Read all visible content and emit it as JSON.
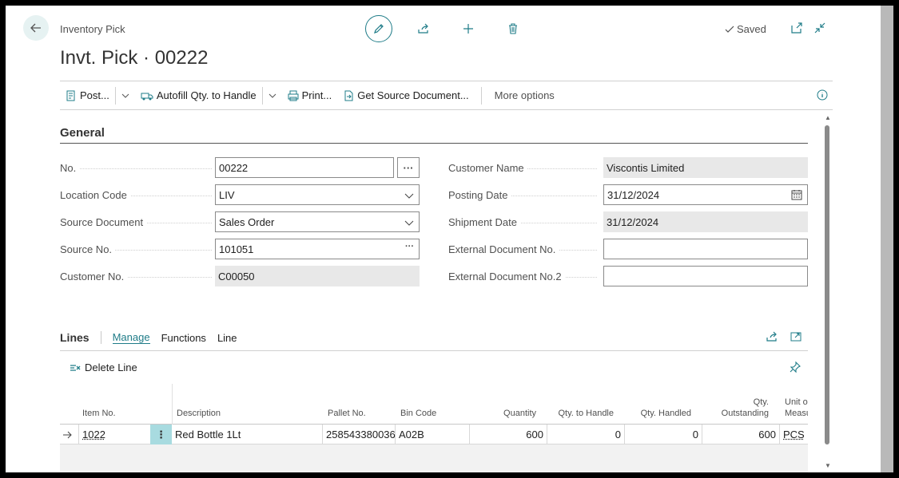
{
  "header": {
    "breadcrumb": "Inventory Pick",
    "title": "Invt. Pick · 00222",
    "status": "Saved"
  },
  "actionbar": {
    "post": "Post...",
    "autofill": "Autofill Qty. to Handle",
    "print": "Print...",
    "get_source": "Get Source Document...",
    "more": "More options"
  },
  "general": {
    "title": "General",
    "fields": {
      "no": {
        "label": "No.",
        "value": "00222"
      },
      "location_code": {
        "label": "Location Code",
        "value": "LIV"
      },
      "source_document": {
        "label": "Source Document",
        "value": "Sales Order"
      },
      "source_no": {
        "label": "Source No.",
        "value": "101051"
      },
      "customer_no": {
        "label": "Customer No.",
        "value": "C00050"
      },
      "customer_name": {
        "label": "Customer Name",
        "value": "Viscontis Limited"
      },
      "posting_date": {
        "label": "Posting Date",
        "value": "31/12/2024"
      },
      "shipment_date": {
        "label": "Shipment Date",
        "value": "31/12/2024"
      },
      "external_doc_no": {
        "label": "External Document No.",
        "value": ""
      },
      "external_doc_no2": {
        "label": "External Document No.2",
        "value": ""
      }
    }
  },
  "lines": {
    "title": "Lines",
    "tabs": [
      "Manage",
      "Functions",
      "Line"
    ],
    "delete_line": "Delete Line",
    "columns": {
      "item_no": "Item No.",
      "description": "Description",
      "pallet_no": "Pallet No.",
      "bin_code": "Bin Code",
      "quantity": "Quantity",
      "qty_to_handle": "Qty. to Handle",
      "qty_handled": "Qty. Handled",
      "qty_outstanding_1": "Qty.",
      "qty_outstanding_2": "Outstanding",
      "unit_1": "Unit o",
      "unit_2": "Measu"
    },
    "rows": [
      {
        "item_no": "1022",
        "description": "Red Bottle 1Lt",
        "pallet_no": "258543380036",
        "bin_code": "A02B",
        "quantity": "600",
        "qty_to_handle": "0",
        "qty_handled": "0",
        "qty_outstanding": "600",
        "unit": "PCS"
      }
    ]
  },
  "colors": {
    "accent": "#1f7c88",
    "readonly_bg": "#e8e8e8"
  }
}
